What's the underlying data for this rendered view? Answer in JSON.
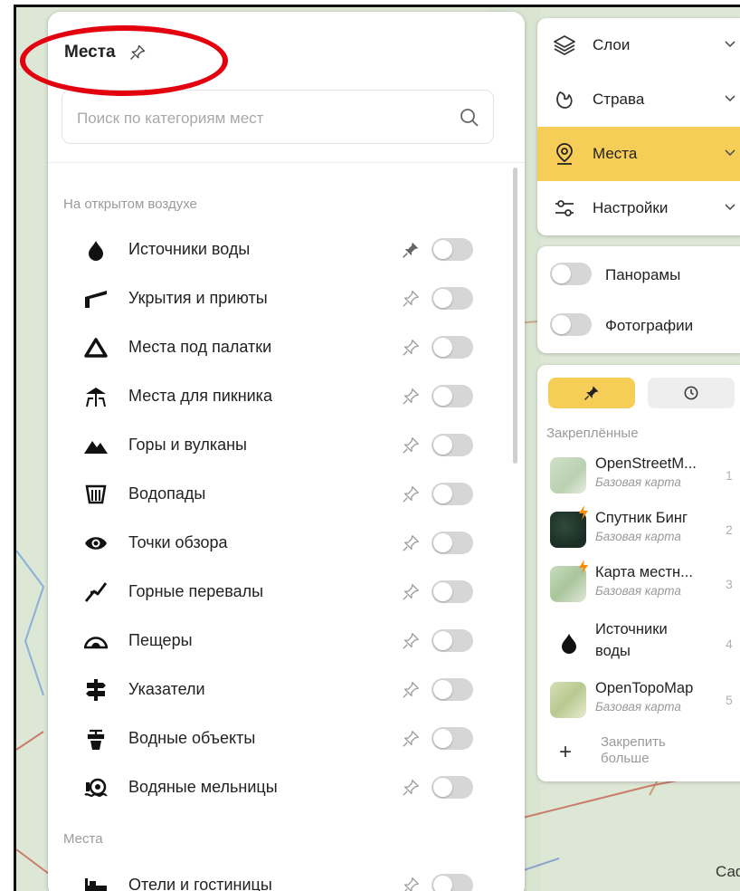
{
  "panel": {
    "title": "Места",
    "search_placeholder": "Поиск по категориям мест",
    "sections": [
      {
        "heading": "На открытом воздухе",
        "items": [
          {
            "label": "Источники воды",
            "icon": "water-drop-icon",
            "pinned": true,
            "enabled": false
          },
          {
            "label": "Укрытия и приюты",
            "icon": "shelter-icon",
            "pinned": false,
            "enabled": false
          },
          {
            "label": "Места под палатки",
            "icon": "tent-icon",
            "pinned": false,
            "enabled": false
          },
          {
            "label": "Места для пикника",
            "icon": "picnic-icon",
            "pinned": false,
            "enabled": false
          },
          {
            "label": "Горы и вулканы",
            "icon": "mountain-icon",
            "pinned": false,
            "enabled": false
          },
          {
            "label": "Водопады",
            "icon": "waterfall-icon",
            "pinned": false,
            "enabled": false
          },
          {
            "label": "Точки обзора",
            "icon": "eye-icon",
            "pinned": false,
            "enabled": false
          },
          {
            "label": "Горные перевалы",
            "icon": "pass-icon",
            "pinned": false,
            "enabled": false
          },
          {
            "label": "Пещеры",
            "icon": "cave-icon",
            "pinned": false,
            "enabled": false
          },
          {
            "label": "Указатели",
            "icon": "signpost-icon",
            "pinned": false,
            "enabled": false
          },
          {
            "label": "Водные объекты",
            "icon": "water-tap-icon",
            "pinned": false,
            "enabled": false
          },
          {
            "label": "Водяные мельницы",
            "icon": "watermill-icon",
            "pinned": false,
            "enabled": false
          }
        ]
      },
      {
        "heading": "Места",
        "items": [
          {
            "label": "Отели и гостиницы",
            "icon": "bed-icon",
            "pinned": false,
            "enabled": false
          }
        ]
      }
    ]
  },
  "menu": {
    "items": [
      {
        "label": "Слои",
        "icon": "layers-icon",
        "active": false
      },
      {
        "label": "Страва",
        "icon": "strava-icon",
        "active": false
      },
      {
        "label": "Места",
        "icon": "place-pin-icon",
        "active": true
      },
      {
        "label": "Настройки",
        "icon": "settings-sliders-icon",
        "active": false
      }
    ]
  },
  "toggles": [
    {
      "label": "Панорамы",
      "enabled": false
    },
    {
      "label": "Фотографии",
      "enabled": false
    }
  ],
  "pinned": {
    "tabs": [
      {
        "icon": "pin-icon",
        "active": true
      },
      {
        "icon": "clock-icon",
        "active": false
      }
    ],
    "heading": "Закреплённые",
    "items": [
      {
        "title": "OpenStreetM...",
        "subtitle": "Базовая карта",
        "index": "1"
      },
      {
        "title": "Спутник Бинг",
        "subtitle": "Базовая карта",
        "index": "2"
      },
      {
        "title": "Карта местн...",
        "subtitle": "Базовая карта",
        "index": "3"
      },
      {
        "title": "Источники воды",
        "subtitle": "",
        "index": "4"
      },
      {
        "title": "OpenTopoMap",
        "subtitle": "Базовая карта",
        "index": "5"
      }
    ],
    "add_label": "Закрепить больше"
  },
  "map": {
    "partial_label": "Саф"
  },
  "colors": {
    "accent": "#f6cd56",
    "annotation": "#e3000f",
    "toggle_off": "#d6d6d6"
  }
}
